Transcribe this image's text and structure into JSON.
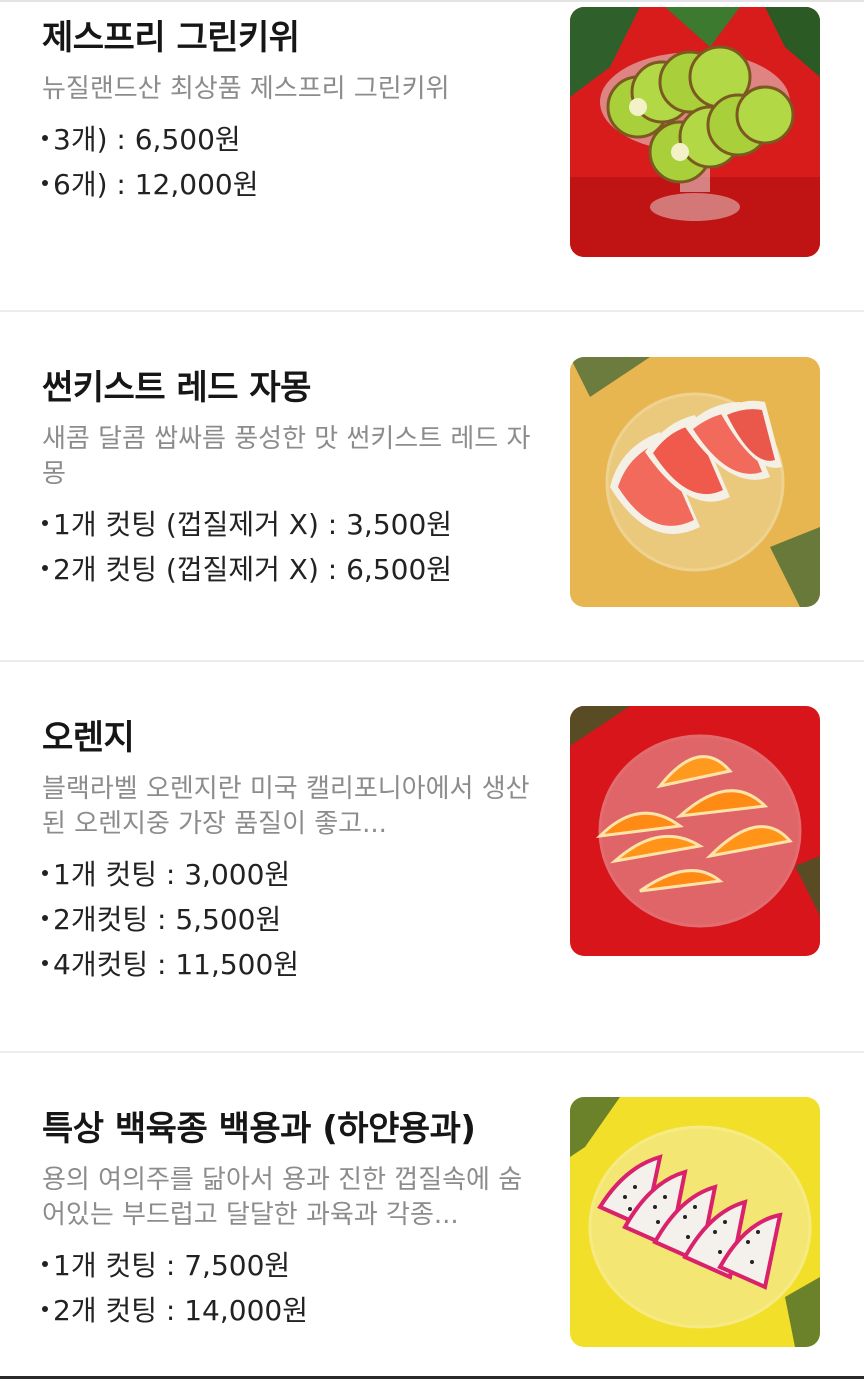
{
  "products": [
    {
      "title": "제스프리 그린키위",
      "description": "뉴질랜드산 최상품 제스프리 그린키위",
      "options": [
        "3개) : 6,500원",
        "6개) : 12,000원"
      ],
      "image_icon": "kiwi-slices-photo",
      "bg_color": "#d81b1b"
    },
    {
      "title": "썬키스트 레드 자몽",
      "description": "새콤 달콤 쌉싸름 풍성한 맛 썬키스트 레드 자몽",
      "options": [
        "1개 컷팅 (껍질제거 X) : 3,500원",
        "2개 컷팅 (껍질제거 X) : 6,500원"
      ],
      "image_icon": "grapefruit-slices-photo",
      "bg_color": "#e7b651"
    },
    {
      "title": "오렌지",
      "description": "블랙라벨 오렌지란 미국 캘리포니아에서 생산된 오렌지중 가장 품질이 좋고...",
      "options": [
        "1개 컷팅 : 3,000원",
        "2개컷팅 : 5,500원",
        "4개컷팅 : 11,500원"
      ],
      "image_icon": "orange-slices-photo",
      "bg_color": "#d8151b"
    },
    {
      "title": "특상 백육종 백용과 (하얀용과)",
      "description": "용의 여의주를 닮아서 용과 진한 껍질속에 숨어있는 부드럽고 달달한 과육과 각종...",
      "options": [
        "1개 컷팅 : 7,500원",
        "2개 컷팅 : 14,000원"
      ],
      "image_icon": "dragonfruit-slices-photo",
      "bg_color": "#f1df2a"
    }
  ]
}
